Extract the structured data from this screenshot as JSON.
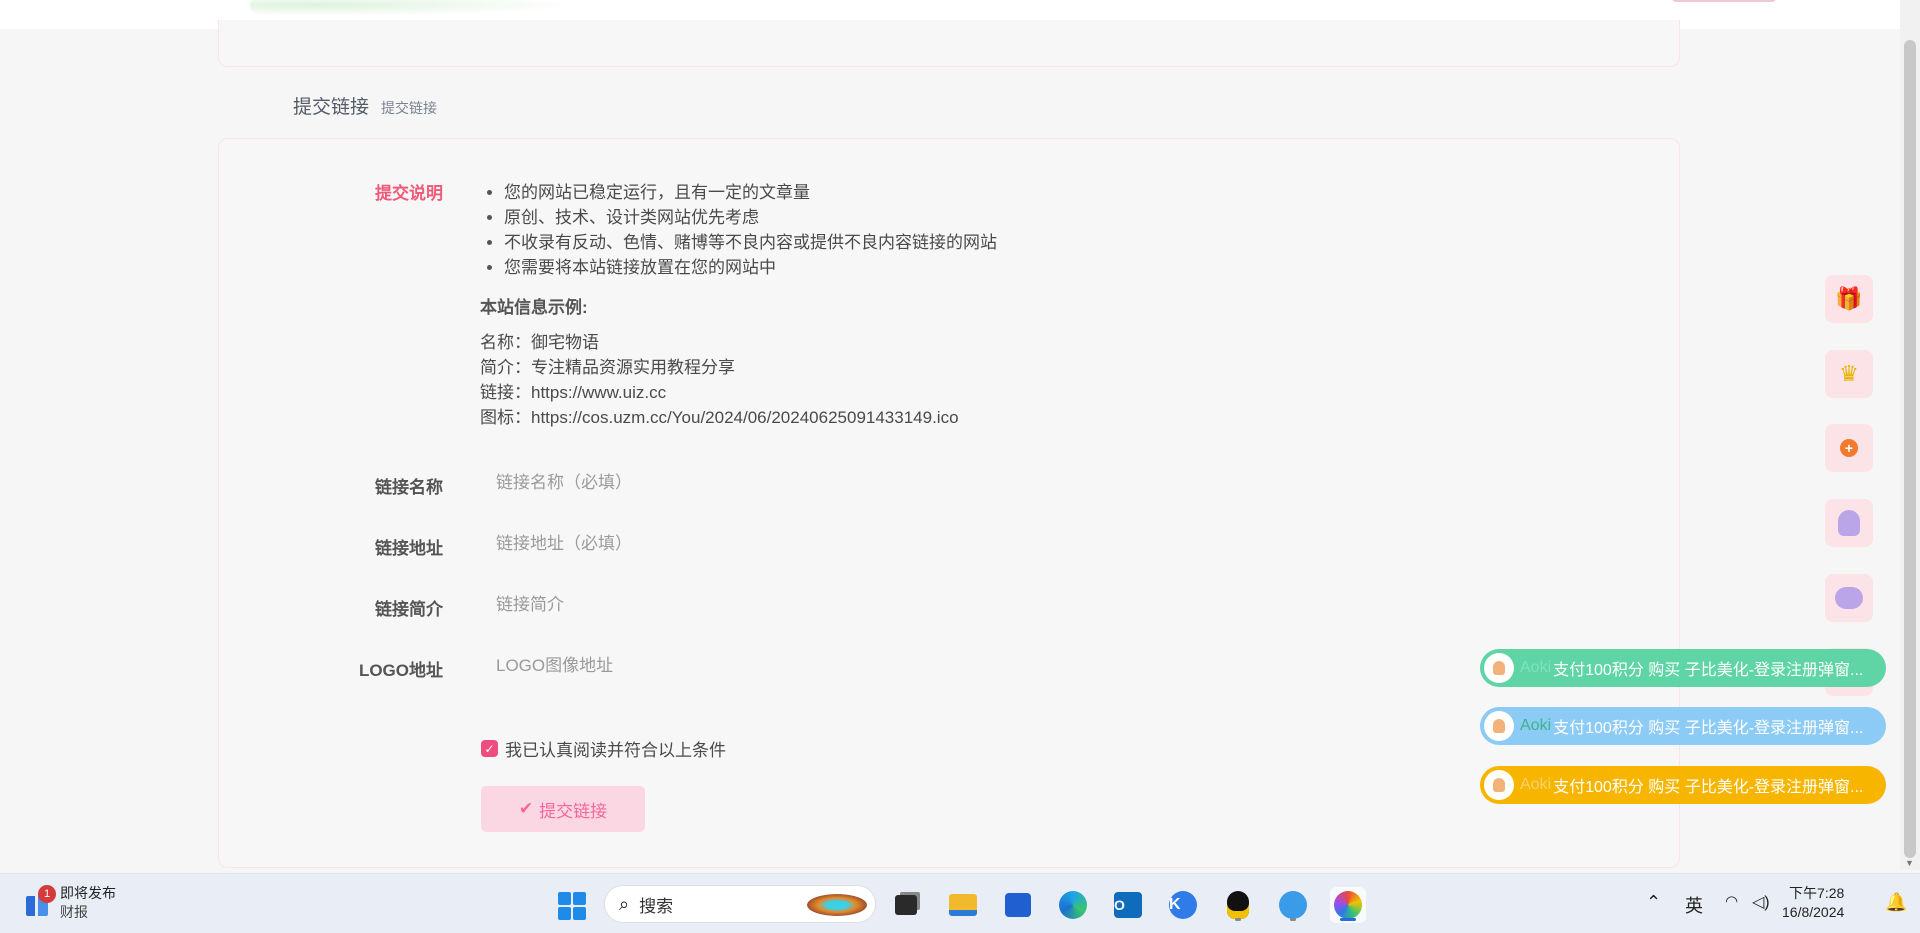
{
  "section": {
    "title": "提交链接",
    "subtitle": "提交链接"
  },
  "form": {
    "instructions_label": "提交说明",
    "rules": [
      "您的网站已稳定运行，且有一定的文章量",
      "原创、技术、设计类网站优先考虑",
      "不收录有反动、色情、赌博等不良内容或提供不良内容链接的网站",
      "您需要将本站链接放置在您的网站中"
    ],
    "example_title": "本站信息示例:",
    "example": {
      "name": "名称：御宅物语",
      "desc": "简介：专注精品资源实用教程分享",
      "link": "链接：https://www.uiz.cc",
      "icon": "图标：https://cos.uzm.cc/You/2024/06/20240625091433149.ico"
    },
    "fields": {
      "name": {
        "label": "链接名称",
        "placeholder": "链接名称（必填）",
        "value": ""
      },
      "url": {
        "label": "链接地址",
        "placeholder": "链接地址（必填）",
        "value": ""
      },
      "intro": {
        "label": "链接简介",
        "placeholder": "链接简介",
        "value": ""
      },
      "logo": {
        "label": "LOGO地址",
        "placeholder": "LOGO图像地址",
        "value": ""
      }
    },
    "agree_text": "我已认真阅读并符合以上条件",
    "agree_checked": true,
    "submit_label": "提交链接"
  },
  "side_buttons": [
    "gift-icon",
    "crown-icon",
    "plus-circle-icon",
    "qq-penguin-icon",
    "wechat-icon",
    "qrcode-icon"
  ],
  "toasts": [
    {
      "user": "Aoki",
      "message": "支付100积分 购买 子比美化-登录注册弹窗...",
      "color": "#5fd4a4"
    },
    {
      "user": "Aoki",
      "message": "支付100积分 购买 子比美化-登录注册弹窗...",
      "color": "#8ccbf5"
    },
    {
      "user": "Aoki",
      "message": "支付100积分 购买 子比美化-登录注册弹窗...",
      "color": "#f7b500"
    }
  ],
  "taskbar": {
    "news_badge": "1",
    "news_title": "即将发布",
    "news_sub": "财报",
    "search_label": "搜索",
    "ime": "英",
    "time": "下午7:28",
    "date": "16/8/2024"
  }
}
